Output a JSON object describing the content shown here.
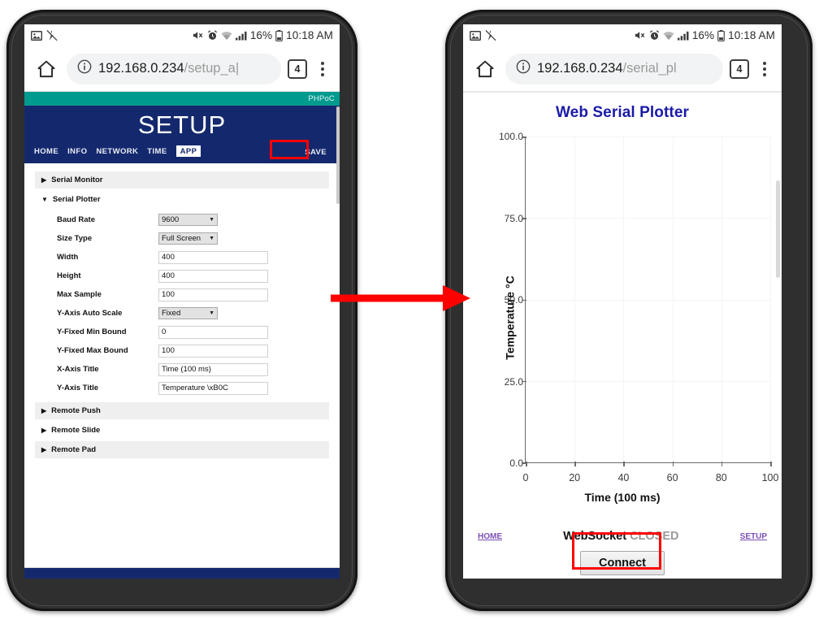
{
  "statusbar": {
    "icons_left": [
      "image-icon",
      "no-sound-icon"
    ],
    "icons_right": [
      "mute-icon",
      "alarm-icon",
      "wifi-icon",
      "signal-icon"
    ],
    "battery_percent": "16%",
    "battery_icon": "battery-icon",
    "time": "10:18 AM"
  },
  "left_phone": {
    "browser": {
      "home_icon": "home-icon",
      "info_icon": "info-circle-icon",
      "url_main": "192.168.0.234",
      "url_path": "/setup_a",
      "url_caret": "|",
      "tab_count": "4",
      "menu_icon": "kebab-menu-icon"
    },
    "page": {
      "brand": "PHPoC",
      "title": "SETUP",
      "nav": [
        {
          "label": "HOME",
          "active": false
        },
        {
          "label": "INFO",
          "active": false
        },
        {
          "label": "NETWORK",
          "active": false
        },
        {
          "label": "TIME",
          "active": false
        },
        {
          "label": "APP",
          "active": true
        }
      ],
      "save_label": "SAVE",
      "accordions": [
        {
          "label": "Serial Monitor",
          "expanded": false,
          "tri": "▶"
        },
        {
          "label": "Serial Plotter",
          "expanded": true,
          "tri": "▼"
        }
      ],
      "fields": [
        {
          "label": "Baud Rate",
          "type": "select",
          "value": "9600"
        },
        {
          "label": "Size Type",
          "type": "select",
          "value": "Full Screen"
        },
        {
          "label": "Width",
          "type": "text",
          "value": "400"
        },
        {
          "label": "Height",
          "type": "text",
          "value": "400"
        },
        {
          "label": "Max Sample",
          "type": "text",
          "value": "100"
        },
        {
          "label": "Y-Axis Auto Scale",
          "type": "select",
          "value": "Fixed"
        },
        {
          "label": "Y-Fixed Min Bound",
          "type": "text",
          "value": "0"
        },
        {
          "label": "Y-Fixed Max Bound",
          "type": "text",
          "value": "100"
        },
        {
          "label": "X-Axis Title",
          "type": "text",
          "value": "Time (100 ms)"
        },
        {
          "label": "Y-Axis Title",
          "type": "text",
          "value": "Temperature \\xB0C"
        }
      ],
      "accordions_bottom": [
        {
          "label": "Remote Push",
          "tri": "▶"
        },
        {
          "label": "Remote Slide",
          "tri": "▶"
        },
        {
          "label": "Remote Pad",
          "tri": "▶"
        }
      ]
    },
    "colors": {
      "teal": "#009a8e",
      "navy": "#14296d",
      "highlight": "#ff0000"
    }
  },
  "right_phone": {
    "browser": {
      "home_icon": "home-icon",
      "info_icon": "info-circle-icon",
      "url_main": "192.168.0.234",
      "url_path": "/serial_pl",
      "tab_count": "4",
      "menu_icon": "kebab-menu-icon"
    },
    "page": {
      "title": "Web Serial Plotter",
      "home_link": "HOME",
      "setup_link": "SETUP",
      "websocket_label": "WebSocket",
      "websocket_state": "CLOSED",
      "connect_button": "Connect"
    },
    "colors": {
      "title": "#1a1aa8",
      "link": "#7a4fb5",
      "state": "#9a9a9a",
      "highlight": "#ff0000"
    }
  },
  "annotation": {
    "arrow_icon": "right-arrow-annotation",
    "arrow_color": "#ff0000"
  },
  "chart_data": {
    "type": "line",
    "title": "Web Serial Plotter",
    "xlabel": "Time (100 ms)",
    "ylabel": "Temperature °C",
    "xlim": [
      0,
      100
    ],
    "ylim": [
      0,
      100
    ],
    "xticks": [
      0,
      20,
      40,
      60,
      80,
      100
    ],
    "xtick_labels": [
      "0",
      "20",
      "40",
      "60",
      "80",
      "100"
    ],
    "yticks": [
      0,
      25,
      50,
      75,
      100
    ],
    "ytick_labels": [
      "0.0",
      "25.0",
      "50.0",
      "75.0",
      "100.0"
    ],
    "grid": true,
    "legend": false,
    "series": [
      {
        "name": "Temperature",
        "x": [],
        "values": []
      }
    ],
    "note": "Empty plot — no data plotted (WebSocket CLOSED)"
  }
}
